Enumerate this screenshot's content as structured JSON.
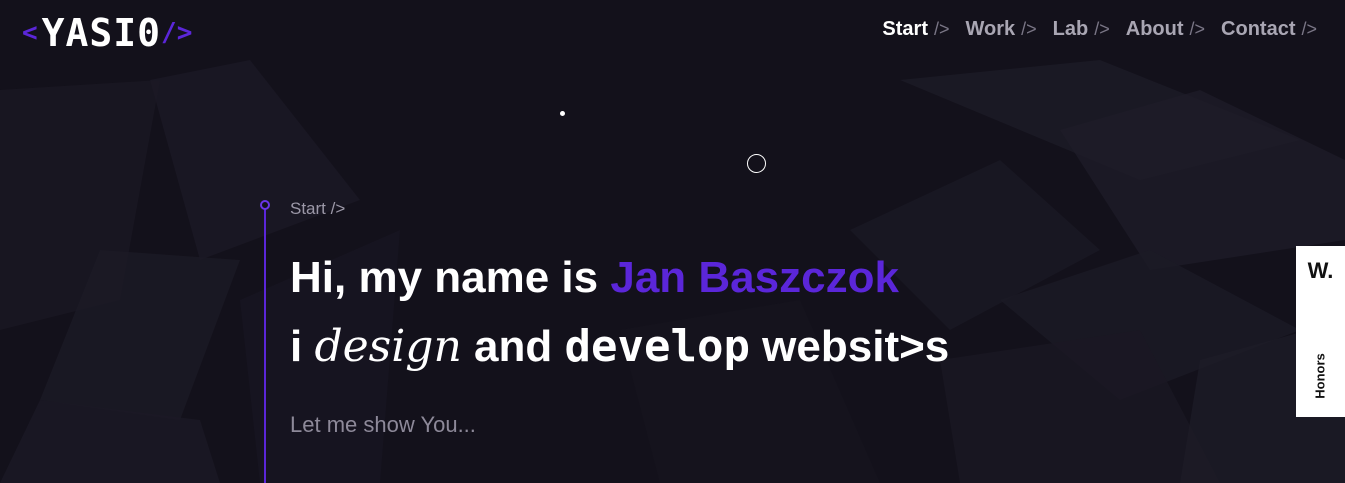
{
  "logo": {
    "open": "<",
    "word": "YASI0",
    "close": "/>"
  },
  "nav": {
    "items": [
      {
        "label": "Start",
        "suffix": "/>",
        "active": true
      },
      {
        "label": "Work",
        "suffix": "/>"
      },
      {
        "label": "Lab",
        "suffix": "/>"
      },
      {
        "label": "About",
        "suffix": "/>"
      },
      {
        "label": "Contact",
        "suffix": "/>"
      }
    ]
  },
  "section": {
    "label": "Start />"
  },
  "hero": {
    "line1_prefix": "Hi, my name is ",
    "name": "Jan Baszczok",
    "line2_i": "i ",
    "line2_design": "design",
    "line2_and": " and ",
    "line2_develop": "develop",
    "line2_websites": " websit>s"
  },
  "subtext": "Let me show You...",
  "honors": {
    "logo": "W.",
    "label": "Honors"
  },
  "colors": {
    "background": "#13111b",
    "accent": "#5b26d9",
    "text": "#ffffff",
    "muted": "#8d8999"
  }
}
